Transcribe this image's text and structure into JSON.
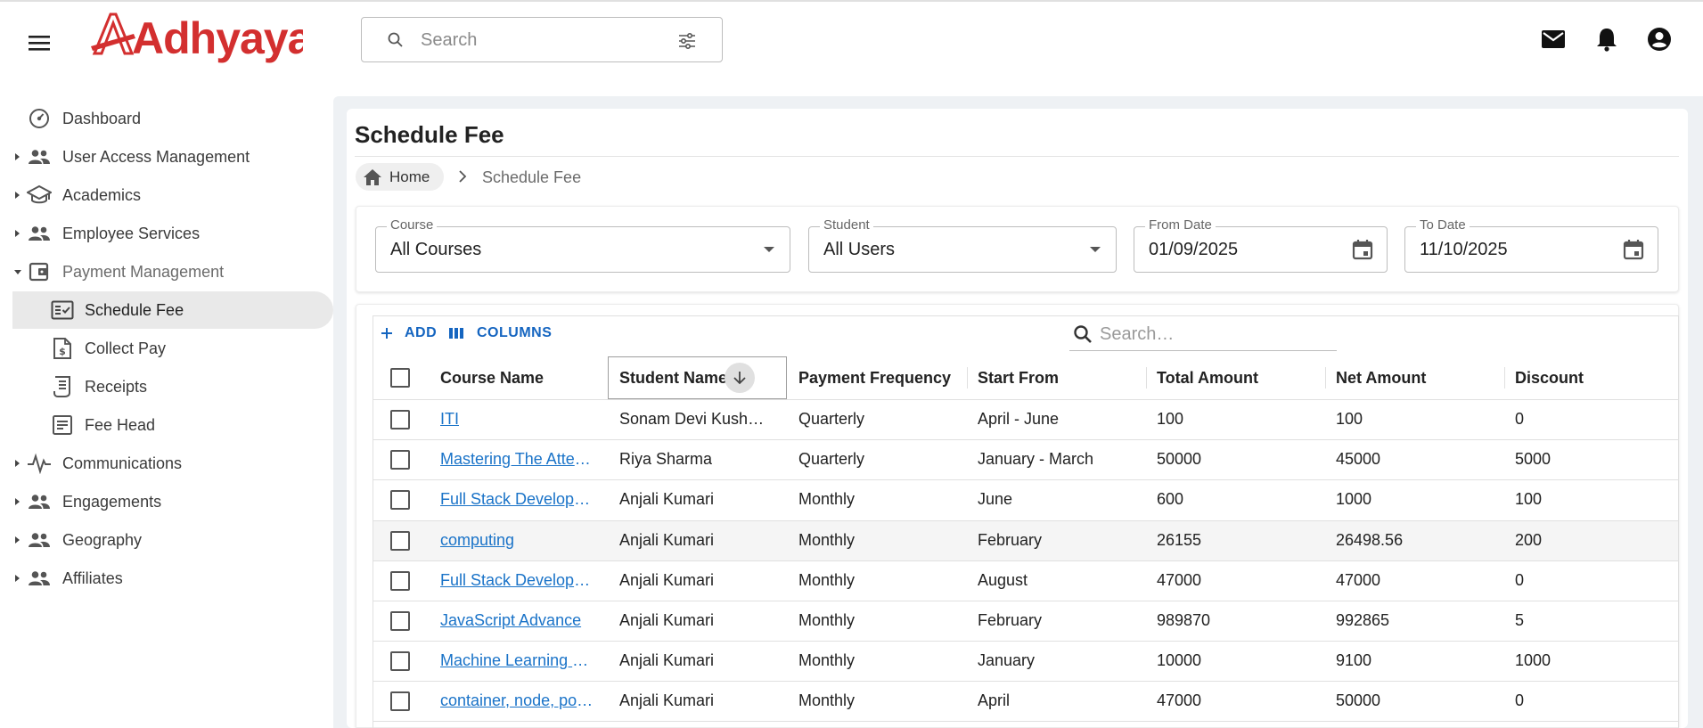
{
  "app": {
    "logo_text": "Adhyayan"
  },
  "header": {
    "search_placeholder": "Search"
  },
  "sidebar": {
    "items": [
      {
        "label": "Dashboard"
      },
      {
        "label": "User Access Management"
      },
      {
        "label": "Academics"
      },
      {
        "label": "Employee Services"
      },
      {
        "label": "Payment Management"
      },
      {
        "label": "Schedule Fee"
      },
      {
        "label": "Collect Pay"
      },
      {
        "label": "Receipts"
      },
      {
        "label": "Fee Head"
      },
      {
        "label": "Communications"
      },
      {
        "label": "Engagements"
      },
      {
        "label": "Geography"
      },
      {
        "label": "Affiliates"
      }
    ]
  },
  "page": {
    "title": "Schedule Fee",
    "breadcrumb": {
      "home": "Home",
      "current": "Schedule Fee"
    }
  },
  "filters": {
    "course": {
      "label": "Course",
      "value": "All Courses"
    },
    "student": {
      "label": "Student",
      "value": "All Users"
    },
    "from_date": {
      "label": "From Date",
      "value": "01/09/2025"
    },
    "to_date": {
      "label": "To Date",
      "value": "11/10/2025"
    }
  },
  "grid": {
    "toolbar": {
      "add_label": "ADD",
      "columns_label": "COLUMNS",
      "search_placeholder": "Search…"
    },
    "columns": [
      "Course Name",
      "Student Name",
      "Payment Frequency",
      "Start From",
      "Total Amount",
      "Net Amount",
      "Discount"
    ],
    "rows": [
      {
        "course": "ITI",
        "student": "Sonam Devi Kushwaha",
        "frequency": "Quarterly",
        "start": "April - June",
        "total": "100",
        "net": "100",
        "discount": "0"
      },
      {
        "course": "Mastering The Attention",
        "student": "Riya Sharma",
        "frequency": "Quarterly",
        "start": "January - March",
        "total": "50000",
        "net": "45000",
        "discount": "5000"
      },
      {
        "course": "Full Stack Development",
        "student": "Anjali Kumari",
        "frequency": "Monthly",
        "start": "June",
        "total": "600",
        "net": "1000",
        "discount": "100"
      },
      {
        "course": "computing",
        "student": "Anjali Kumari",
        "frequency": "Monthly",
        "start": "February",
        "total": "26155",
        "net": "26498.56",
        "discount": "200"
      },
      {
        "course": "Full Stack Development",
        "student": "Anjali Kumari",
        "frequency": "Monthly",
        "start": "August",
        "total": "47000",
        "net": "47000",
        "discount": "0"
      },
      {
        "course": "JavaScript Advance",
        "student": "Anjali Kumari",
        "frequency": "Monthly",
        "start": "February",
        "total": "989870",
        "net": "992865",
        "discount": "5"
      },
      {
        "course": "Machine Learning & AI",
        "student": "Anjali Kumari",
        "frequency": "Monthly",
        "start": "January",
        "total": "10000",
        "net": "9100",
        "discount": "1000"
      },
      {
        "course": "container, node, pod, cluster",
        "student": "Anjali Kumari",
        "frequency": "Monthly",
        "start": "April",
        "total": "47000",
        "net": "50000",
        "discount": "0"
      }
    ]
  },
  "colors": {
    "brand_red": "#d32f2f",
    "link_blue": "#1a73c8",
    "primary_blue": "#1565c0"
  }
}
